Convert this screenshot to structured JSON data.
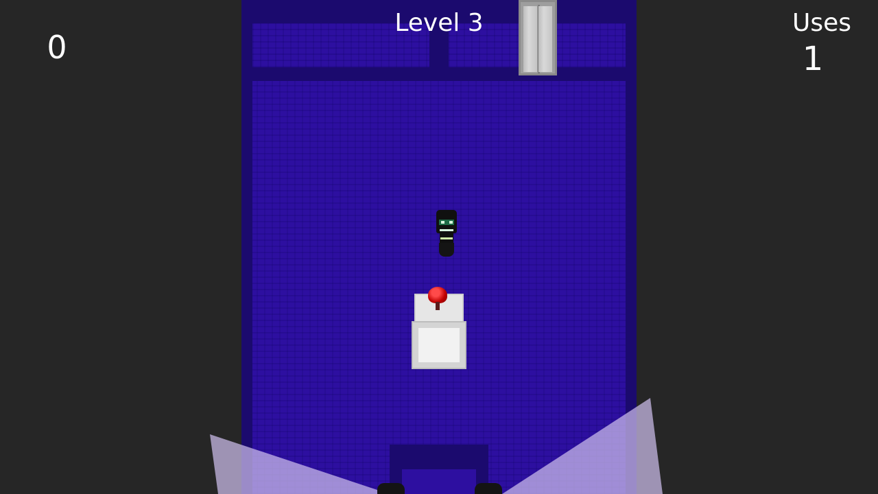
{
  "hud": {
    "score": "0",
    "level": "Level 3",
    "uses_label": "Uses",
    "uses_value": "1"
  },
  "scene": {
    "icons": {
      "player": "player-sprite-icon",
      "bed": "bed-icon",
      "item": "red-alarm-icon",
      "door": "door-icon",
      "guard": "guard-icon"
    },
    "colors": {
      "background": "#262626",
      "floor": "#2d0fa0",
      "wall": "#1b0a6e",
      "light_cone": "#cdbeeb",
      "hud_text": "#ffffff"
    }
  }
}
